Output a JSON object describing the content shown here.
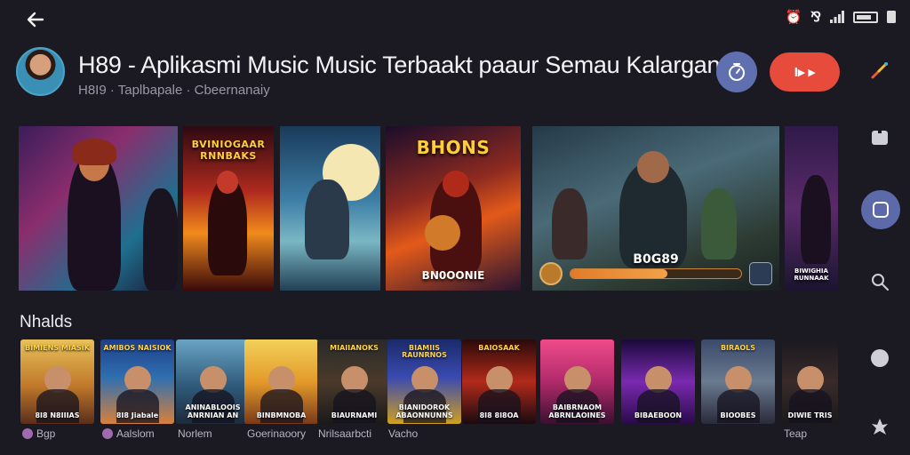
{
  "status_bar": {
    "icons": [
      "alarm-icon",
      "vibrate-icon",
      "signal-icon",
      "battery-icon"
    ]
  },
  "header": {
    "back_icon": "arrow-left-icon",
    "title": "H89 - Aplikasmi Music Music Terbaakt paaur Semau Kalargan",
    "subtitle": "H8I9 · Taplbapale · Cbeernanaiy",
    "timer_icon": "timer-icon",
    "play_label": "I▸ ▸"
  },
  "rail": {
    "icons": [
      "brush-icon",
      "square-icon",
      "library-icon",
      "search-icon",
      "circle-icon",
      "leaf-icon"
    ]
  },
  "featured": [
    {
      "caption": ""
    },
    {
      "caption": "BVINIOGAAR RNNBAKS"
    },
    {
      "caption": ""
    },
    {
      "caption": "BHONS",
      "bottom": "BN0OONIE"
    },
    {
      "caption": "B0G89",
      "progress": 0.57
    },
    {
      "caption": "BIWIGHIA RUNNAAK"
    }
  ],
  "section": {
    "title": "Nhalds"
  },
  "tiles": [
    {
      "top": "BIMIENS MIASIK",
      "bottom": "8I8 N8IIIAS",
      "label": "Bgp",
      "has_avatar": true
    },
    {
      "top": "AMIBOS NAISIOK",
      "bottom": "8I8 Jiabale",
      "label": "Aalslom",
      "has_avatar": true
    },
    {
      "top": "",
      "bottom": "ANINABLOOIS ANRNIAN AN",
      "label": "Norlem",
      "has_avatar": false
    },
    {
      "top": "",
      "bottom": "BINBMNOBA",
      "label": "Goerinaoory",
      "has_avatar": false
    },
    {
      "top": "MIAIIANOKS",
      "bottom": "BIAURNAMI",
      "label": "Nrilsaarbcti",
      "has_avatar": false
    },
    {
      "top": "BIAMIIS RAUNRNOS",
      "bottom": "BIANIDOROK ABAONNUNNS",
      "label": "Vacho",
      "has_avatar": false
    },
    {
      "top": "BAIOSAAK",
      "bottom": "8I8 8I8OA",
      "label": "",
      "has_avatar": false
    },
    {
      "top": "",
      "bottom": "BAIBRNAOM ABRNLAOINES",
      "label": "",
      "has_avatar": false
    },
    {
      "top": "",
      "bottom": "BIBAEBOON",
      "label": "",
      "has_avatar": false
    },
    {
      "top": "BIRAOLS",
      "bottom": "BIOOBES",
      "label": "",
      "has_avatar": false
    },
    {
      "top": "",
      "bottom": "DIWIE TRIS",
      "label": "Teap",
      "has_avatar": false
    }
  ],
  "colors": {
    "background": "#1b1a22",
    "accent_blue": "#5f6fb0",
    "accent_red": "#e64b3c"
  }
}
